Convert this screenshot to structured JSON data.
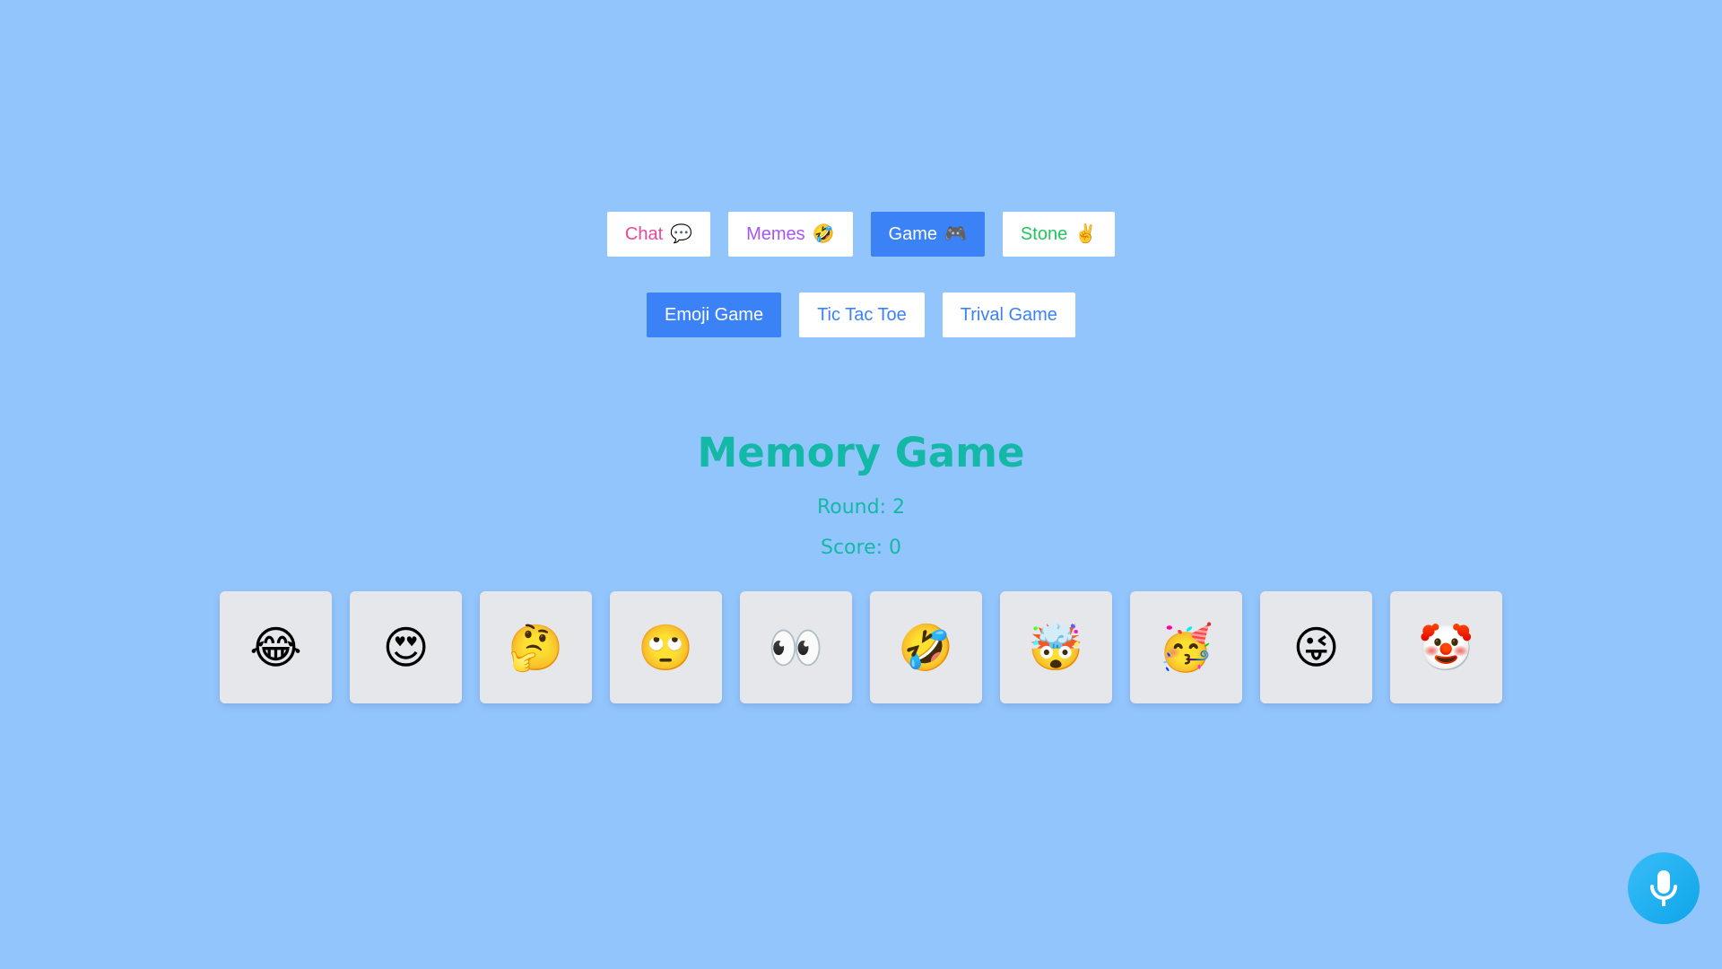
{
  "nav": {
    "main": [
      {
        "label": "Chat",
        "icon": "💬",
        "color": "#ec4899",
        "active": false
      },
      {
        "label": "Memes",
        "icon": "🤣",
        "color": "#a855f7",
        "active": false
      },
      {
        "label": "Game",
        "icon": "🎮",
        "color": "#ffffff",
        "active": true
      },
      {
        "label": "Stone",
        "icon": "✌️",
        "color": "#22c55e",
        "active": false
      }
    ],
    "sub": [
      {
        "label": "Emoji Game",
        "color": "#ffffff",
        "active": true
      },
      {
        "label": "Tic Tac Toe",
        "color": "#3b82f6",
        "active": false
      },
      {
        "label": "Trival Game",
        "color": "#3b82f6",
        "active": false
      }
    ]
  },
  "game": {
    "title": "Memory Game",
    "round_text": "Round: 2",
    "score_text": "Score: 0",
    "cards": [
      "😂",
      "😍",
      "🤔",
      "🙄",
      "👀",
      "🤣",
      "🤯",
      "🥳",
      "😜",
      "🤡"
    ]
  },
  "mic": {
    "icon": "microphone-icon"
  },
  "colors": {
    "background": "#93c5fd",
    "accent": "#3b82f6",
    "title": "#14b8a6",
    "card": "#e5e7eb"
  }
}
